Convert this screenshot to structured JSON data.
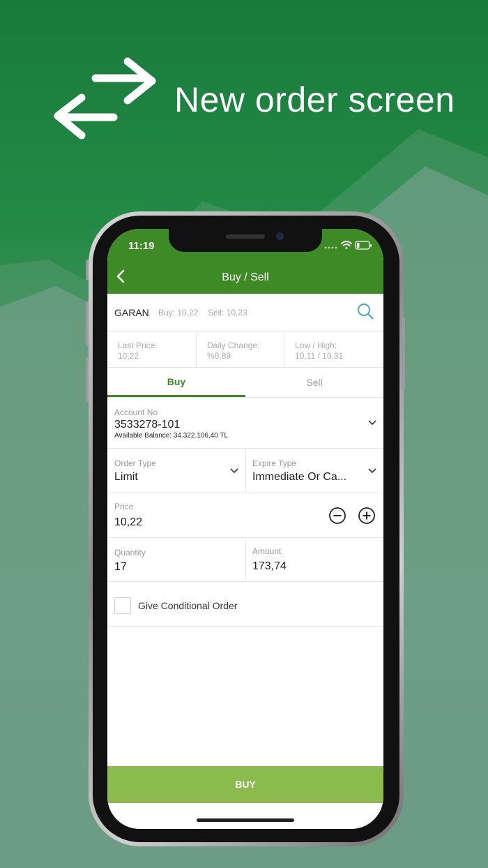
{
  "hero": {
    "title": "New order screen",
    "icon": "swap-arrows-icon"
  },
  "status_bar": {
    "time": "11:19"
  },
  "header": {
    "title": "Buy / Sell"
  },
  "symbol": {
    "code": "GARAN",
    "buy": "Buy: 10,22",
    "sell": "Sell: 10,23"
  },
  "stats": [
    {
      "label": "Last Price:",
      "value": "10,22"
    },
    {
      "label": "Daily Change:",
      "value": "%0,89"
    },
    {
      "label": "Low / High:",
      "value": "10,11 / 10,31"
    }
  ],
  "tabs": [
    {
      "label": "Buy",
      "active": true
    },
    {
      "label": "Sell",
      "active": false
    }
  ],
  "account": {
    "label": "Account No",
    "value": "3533278-101",
    "balance": "Available Balance: 34.322.106,40 TL"
  },
  "order_type": {
    "label": "Order Type",
    "value": "Limit"
  },
  "expire_type": {
    "label": "Expire Type",
    "value": "Immediate Or Ca..."
  },
  "price": {
    "label": "Price",
    "value": "10,22"
  },
  "quantity": {
    "label": "Quantity",
    "value": "17"
  },
  "amount": {
    "label": "Amount",
    "value": "173,74"
  },
  "conditional": {
    "label": "Give Conditional Order",
    "checked": false
  },
  "action": {
    "label": "BUY"
  },
  "colors": {
    "brand_green": "#3d8a26",
    "buy_button": "#8abb4c",
    "search_icon": "#4aa3c8"
  }
}
